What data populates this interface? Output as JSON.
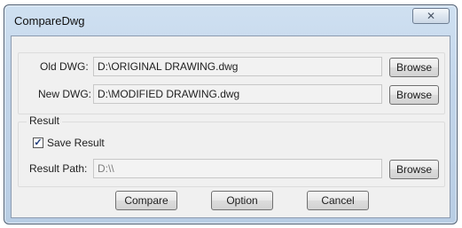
{
  "window": {
    "title": "CompareDwg",
    "close_glyph": "✕"
  },
  "old_dwg": {
    "label": "Old DWG:",
    "value": "D:\\ORIGINAL DRAWING.dwg",
    "browse_label": "Browse"
  },
  "new_dwg": {
    "label": "New DWG:",
    "value": "D:\\MODIFIED DRAWING.dwg",
    "browse_label": "Browse"
  },
  "result": {
    "group_label": "Result",
    "save_result": {
      "label": "Save Result",
      "checked": true,
      "check_glyph": "✓"
    },
    "path_label": "Result Path:",
    "path_value": "D:\\\\",
    "browse_label": "Browse"
  },
  "footer": {
    "compare_label": "Compare",
    "option_label": "Option",
    "cancel_label": "Cancel"
  }
}
